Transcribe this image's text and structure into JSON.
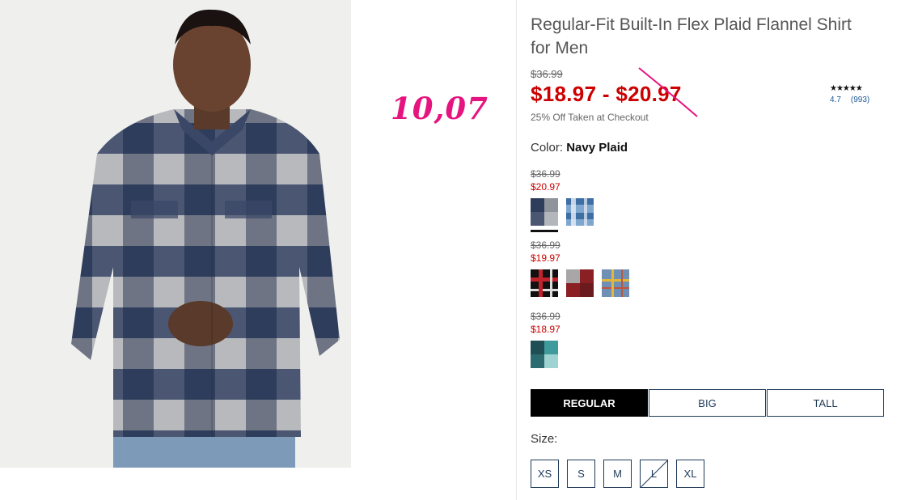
{
  "overlay": {
    "handwritten_note": "10,07"
  },
  "product": {
    "title": "Regular-Fit Built-In Flex Plaid Flannel Shirt for Men",
    "original_price": "$36.99",
    "sale_range": "$18.97 - $20.97",
    "promo": "25% Off Taken at Checkout",
    "rating": {
      "stars": "★★★★★",
      "score": "4.7",
      "count": "(993)"
    },
    "color_label": "Color:",
    "color_value": "Navy Plaid"
  },
  "color_groups": [
    {
      "was": "$36.99",
      "now": "$20.97",
      "swatches": [
        {
          "name": "navy-plaid-swatch",
          "selected": true
        },
        {
          "name": "blue-plaid-swatch",
          "selected": false
        }
      ]
    },
    {
      "was": "$36.99",
      "now": "$19.97",
      "swatches": [
        {
          "name": "black-red-plaid-swatch"
        },
        {
          "name": "red-gray-plaid-swatch"
        },
        {
          "name": "blue-yellow-plaid-swatch"
        }
      ]
    },
    {
      "was": "$36.99",
      "now": "$18.97",
      "swatches": [
        {
          "name": "teal-plaid-swatch"
        }
      ]
    }
  ],
  "fit_tabs": [
    {
      "label": "REGULAR",
      "active": true
    },
    {
      "label": "BIG",
      "active": false
    },
    {
      "label": "TALL",
      "active": false
    }
  ],
  "size_label": "Size:",
  "sizes": [
    {
      "label": "XS",
      "available": true
    },
    {
      "label": "S",
      "available": true
    },
    {
      "label": "M",
      "available": true
    },
    {
      "label": "L",
      "available": false
    },
    {
      "label": "XL",
      "available": true
    }
  ],
  "colors": {
    "sale_red": "#cc0000",
    "nav_blue": "#1f3a5a",
    "note_pink": "#e6147f"
  }
}
